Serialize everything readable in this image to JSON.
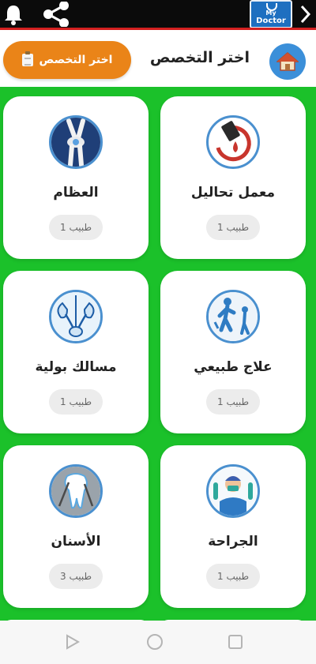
{
  "header": {
    "title": "اختر التخصص",
    "choose_button": "اختر التخصص"
  },
  "logo": {
    "line1": "My",
    "line2": "Doctor"
  },
  "colors": {
    "topbar": "#0b0b0b",
    "accent_red": "#d42020",
    "home": "#3b8fd9",
    "orange": "#ea8418",
    "green": "#1bc12a"
  },
  "specialties": [
    {
      "name": "معمل تحاليل",
      "count": "1 طبيب",
      "icon": "lab-icon"
    },
    {
      "name": "العظام",
      "count": "1 طبيب",
      "icon": "bones-icon"
    },
    {
      "name": "علاج طبيعي",
      "count": "1 طبيب",
      "icon": "physiotherapy-icon"
    },
    {
      "name": "مسالك بولية",
      "count": "1 طبيب",
      "icon": "urology-icon"
    },
    {
      "name": "الجراحة",
      "count": "1 طبيب",
      "icon": "surgeon-icon"
    },
    {
      "name": "الأسنان",
      "count": "3 طبيب",
      "icon": "tooth-icon"
    }
  ]
}
